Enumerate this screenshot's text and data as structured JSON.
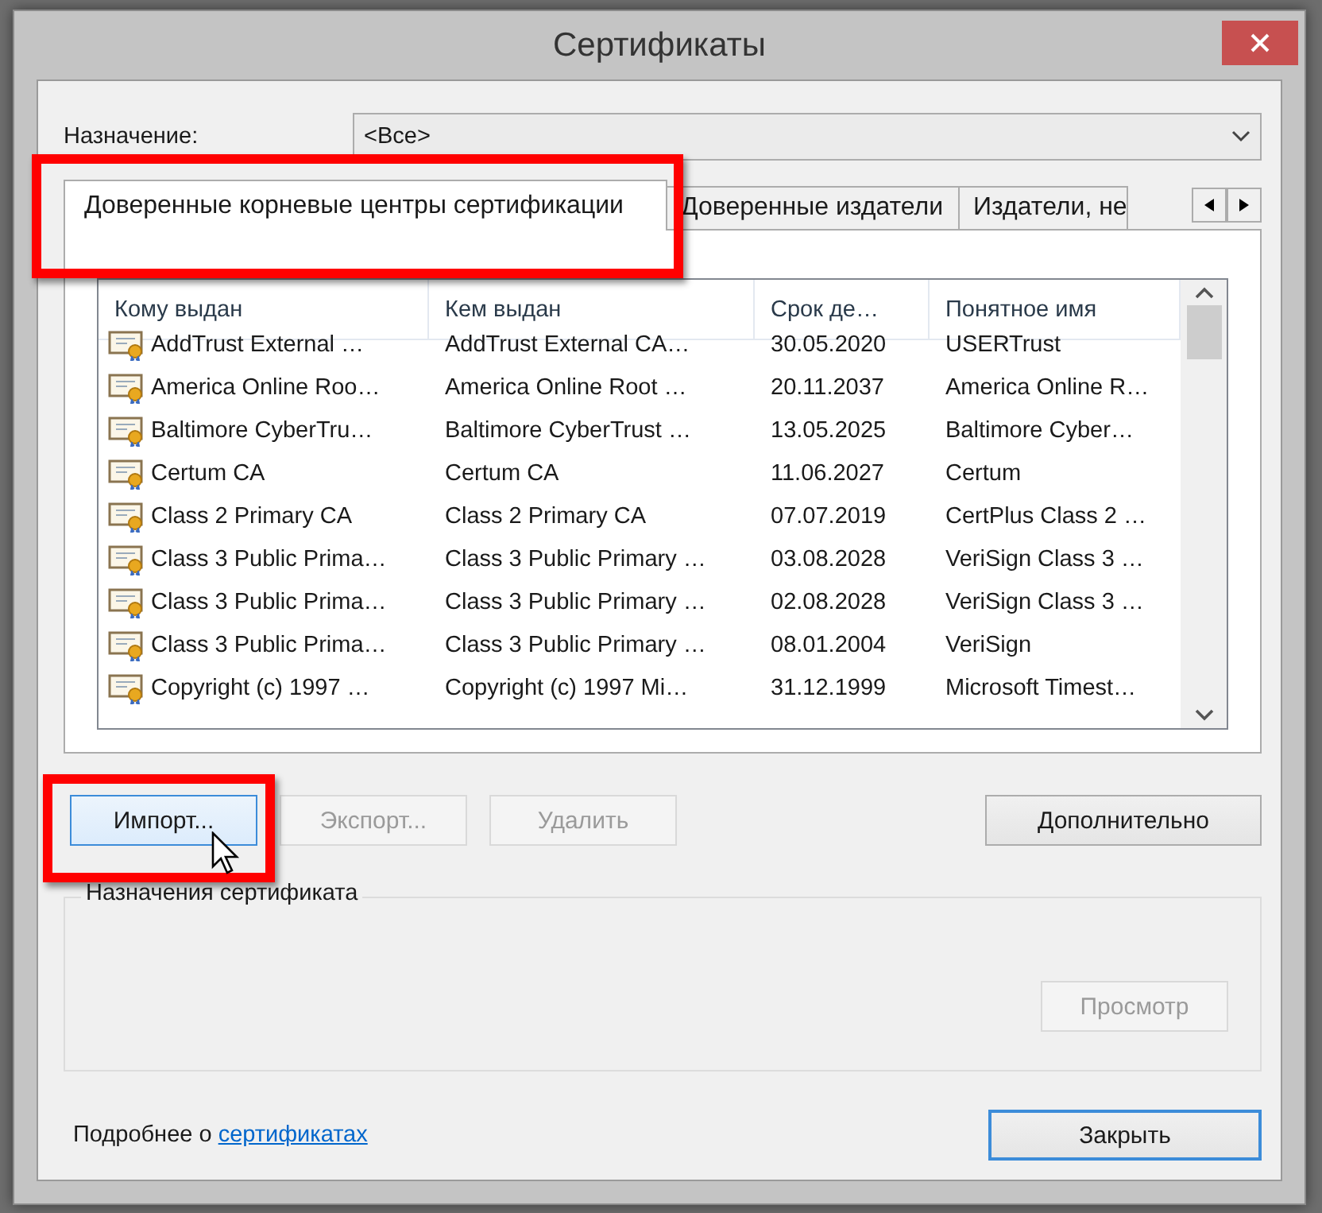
{
  "window": {
    "title": "Сертификаты"
  },
  "purpose": {
    "label": "Назначение:",
    "value": "<Все>"
  },
  "tabs": [
    {
      "label": "Доверенные корневые центры сертификации",
      "selected": true
    },
    {
      "label": "Доверенные издатели",
      "selected": false
    },
    {
      "label": "Издатели, не",
      "selected": false
    }
  ],
  "table": {
    "columns": [
      "Кому выдан",
      "Кем выдан",
      "Срок де…",
      "Понятное имя"
    ],
    "rows": [
      [
        "AddTrust External …",
        "AddTrust External CA…",
        "30.05.2020",
        "USERTrust"
      ],
      [
        "America Online Roo…",
        "America Online Root …",
        "20.11.2037",
        "America Online R…"
      ],
      [
        "Baltimore CyberTru…",
        "Baltimore CyberTrust …",
        "13.05.2025",
        "Baltimore Cyber…"
      ],
      [
        "Certum CA",
        "Certum CA",
        "11.06.2027",
        "Certum"
      ],
      [
        "Class 2 Primary CA",
        "Class 2 Primary CA",
        "07.07.2019",
        "CertPlus Class 2 …"
      ],
      [
        "Class 3 Public Prima…",
        "Class 3 Public Primary …",
        "03.08.2028",
        "VeriSign Class 3 …"
      ],
      [
        "Class 3 Public Prima…",
        "Class 3 Public Primary …",
        "02.08.2028",
        "VeriSign Class 3 …"
      ],
      [
        "Class 3 Public Prima…",
        "Class 3 Public Primary …",
        "08.01.2004",
        "VeriSign"
      ],
      [
        "Copyright (c) 1997 …",
        "Copyright (c) 1997 Mi…",
        "31.12.1999",
        "Microsoft Timest…"
      ]
    ]
  },
  "actions": [
    {
      "label": "Импорт...",
      "disabled": false,
      "hovered": true
    },
    {
      "label": "Экспорт...",
      "disabled": true,
      "hovered": false
    },
    {
      "label": "Удалить",
      "disabled": true,
      "hovered": false
    }
  ],
  "advanced_button": {
    "label": "Дополнительно"
  },
  "purposes_group": {
    "label": "Назначения сертификата",
    "view_button": {
      "label": "Просмотр",
      "disabled": true
    }
  },
  "footer": {
    "text": "Подробнее о",
    "link": "сертификатах",
    "close_button": {
      "label": "Закрыть"
    }
  }
}
